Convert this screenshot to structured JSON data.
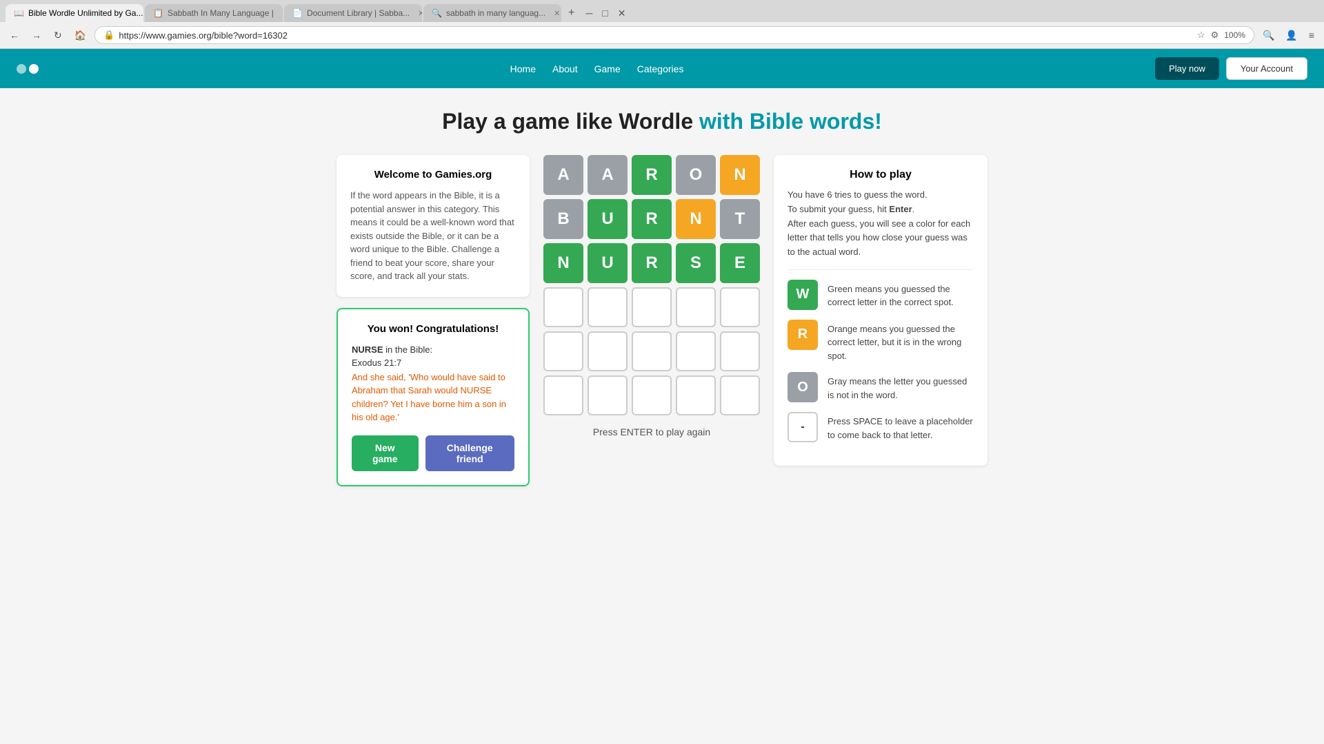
{
  "browser": {
    "tabs": [
      {
        "id": "tab1",
        "label": "Bible Wordle Unlimited by Ga...",
        "active": true,
        "favicon": "📖"
      },
      {
        "id": "tab2",
        "label": "Sabbath In Many Language |",
        "active": false,
        "favicon": "📋"
      },
      {
        "id": "tab3",
        "label": "Document Library | Sabba...",
        "active": false,
        "favicon": "📄"
      },
      {
        "id": "tab4",
        "label": "sabbath in many languag...",
        "active": false,
        "favicon": "🔍"
      }
    ],
    "url": "https://www.gamies.org/bible?word=16302",
    "zoom": "100%"
  },
  "header": {
    "nav_links": [
      "Home",
      "About",
      "Game",
      "Categories"
    ],
    "btn_play": "Play now",
    "btn_account": "Your Account"
  },
  "page_title_start": "Play a game like Wordle ",
  "page_title_colored": "with Bible words!",
  "welcome": {
    "title": "Welcome to Gamies.org",
    "text": "If the word appears in the Bible, it is a potential answer in this category. This means it could be a well-known word that exists outside the Bible, or it can be a word unique to the Bible. Challenge a friend to beat your score, share your score, and track all your stats."
  },
  "congrats": {
    "title": "You won! Congratulations!",
    "word": "NURSE",
    "bible_label": " in the Bible:",
    "ref": "Exodus 21:7",
    "verse": "And she said, 'Who would have said to Abraham that Sarah would NURSE children? Yet I have borne him a son in his old age.'",
    "btn_new_game": "New game",
    "btn_challenge": "Challenge friend"
  },
  "board": {
    "rows": [
      [
        {
          "letter": "A",
          "color": "gray"
        },
        {
          "letter": "A",
          "color": "gray"
        },
        {
          "letter": "R",
          "color": "green"
        },
        {
          "letter": "O",
          "color": "gray"
        },
        {
          "letter": "N",
          "color": "orange"
        }
      ],
      [
        {
          "letter": "B",
          "color": "gray"
        },
        {
          "letter": "U",
          "color": "green"
        },
        {
          "letter": "R",
          "color": "green"
        },
        {
          "letter": "N",
          "color": "orange"
        },
        {
          "letter": "T",
          "color": "gray"
        }
      ],
      [
        {
          "letter": "N",
          "color": "green"
        },
        {
          "letter": "U",
          "color": "green"
        },
        {
          "letter": "R",
          "color": "green"
        },
        {
          "letter": "S",
          "color": "green"
        },
        {
          "letter": "E",
          "color": "green"
        }
      ],
      [
        {
          "letter": "",
          "color": "empty"
        },
        {
          "letter": "",
          "color": "empty"
        },
        {
          "letter": "",
          "color": "empty"
        },
        {
          "letter": "",
          "color": "empty"
        },
        {
          "letter": "",
          "color": "empty"
        }
      ],
      [
        {
          "letter": "",
          "color": "empty"
        },
        {
          "letter": "",
          "color": "empty"
        },
        {
          "letter": "",
          "color": "empty"
        },
        {
          "letter": "",
          "color": "empty"
        },
        {
          "letter": "",
          "color": "empty"
        }
      ],
      [
        {
          "letter": "",
          "color": "empty"
        },
        {
          "letter": "",
          "color": "empty"
        },
        {
          "letter": "",
          "color": "empty"
        },
        {
          "letter": "",
          "color": "empty"
        },
        {
          "letter": "",
          "color": "empty"
        }
      ]
    ],
    "press_enter": "Press ENTER to play again"
  },
  "how_to_play": {
    "title": "How to play",
    "intro_line1": "You have 6 tries to guess the word.",
    "intro_line2": "To submit your guess, hit Enter.",
    "intro_line3": "After each guess, you will see a color for each letter that tells you how close your guess was to the actual word.",
    "legend": [
      {
        "letter": "W",
        "color": "green",
        "text": "Green means you guessed the correct letter in the correct spot."
      },
      {
        "letter": "R",
        "color": "orange",
        "text": "Orange means you guessed the correct letter, but it is in the wrong spot."
      },
      {
        "letter": "O",
        "color": "gray",
        "text": "Gray means the letter you guessed is not in the word."
      },
      {
        "letter": "-",
        "color": "empty",
        "text": "Press SPACE to leave a placeholder to come back to that letter."
      }
    ]
  }
}
